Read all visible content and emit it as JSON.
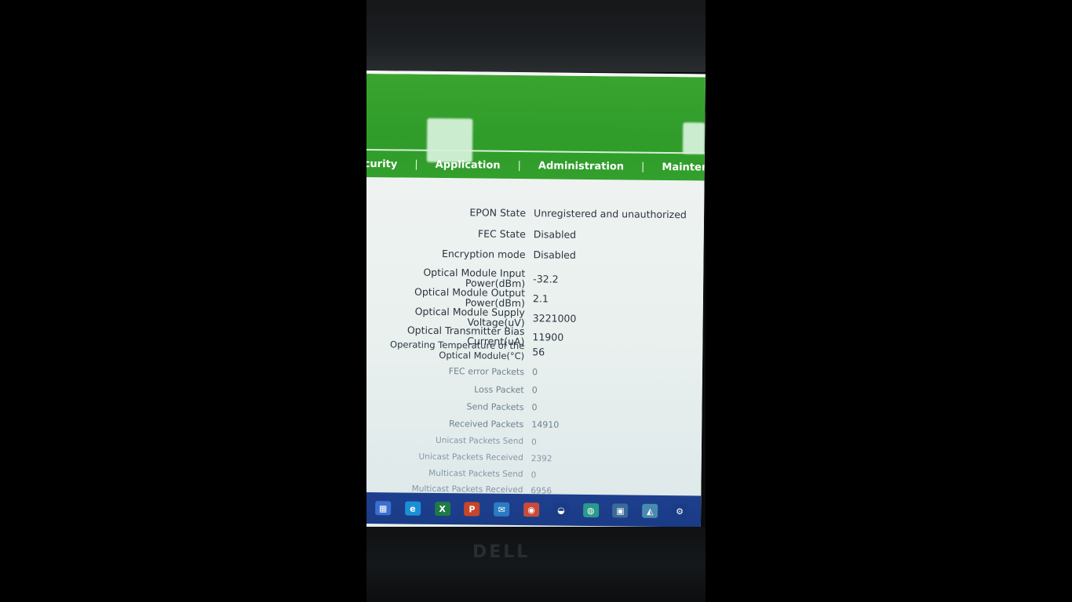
{
  "nav": {
    "items": [
      {
        "id": "security",
        "label": "curity"
      },
      {
        "id": "application",
        "label": "Application"
      },
      {
        "id": "administration",
        "label": "Administration"
      },
      {
        "id": "maintenance",
        "label": "Maintenan"
      }
    ],
    "separator": "|"
  },
  "status": {
    "rows": [
      {
        "label": "EPON State",
        "value": "Unregistered and unauthorized"
      },
      {
        "label": "FEC State",
        "value": "Disabled"
      },
      {
        "label": "Encryption mode",
        "value": "Disabled"
      },
      {
        "label": "Optical Module Input Power(dBm)",
        "value": "-32.2"
      },
      {
        "label": "Optical Module Output Power(dBm)",
        "value": "2.1"
      },
      {
        "label": "Optical Module Supply Voltage(uV)",
        "value": "3221000"
      },
      {
        "label": "Optical Transmitter Bias Current(uA)",
        "value": "11900"
      },
      {
        "label": "Operating Temperature of the Optical Module(°C)",
        "value": "56"
      },
      {
        "label": "FEC error Packets",
        "value": "0"
      },
      {
        "label": "Loss Packet",
        "value": "0"
      },
      {
        "label": "Send Packets",
        "value": "0"
      },
      {
        "label": "Received Packets",
        "value": "14910"
      },
      {
        "label": "Unicast Packets Send",
        "value": "0"
      },
      {
        "label": "Unicast Packets Received",
        "value": "2392"
      },
      {
        "label": "Multicast Packets Send",
        "value": "0"
      },
      {
        "label": "Multicast Packets Received",
        "value": "6956"
      }
    ]
  },
  "taskbar": {
    "icons": [
      {
        "name": "windows-start-icon",
        "glyph": "▦",
        "color": "#3b6fd0"
      },
      {
        "name": "edge-browser-icon",
        "glyph": "e",
        "color": "#1b8fd6"
      },
      {
        "name": "excel-icon",
        "glyph": "X",
        "color": "#1f7a45"
      },
      {
        "name": "powerpoint-icon",
        "glyph": "P",
        "color": "#c8452a"
      },
      {
        "name": "mail-icon",
        "glyph": "✉",
        "color": "#2a7bc4"
      },
      {
        "name": "chrome-icon",
        "glyph": "◉",
        "color": "#c94a3a"
      },
      {
        "name": "app-icon",
        "glyph": "◒",
        "color": "#1a3b86"
      },
      {
        "name": "globe-icon",
        "glyph": "◍",
        "color": "#2a9a8a"
      },
      {
        "name": "store-icon",
        "glyph": "▣",
        "color": "#3a6a9a"
      },
      {
        "name": "photos-icon",
        "glyph": "◭",
        "color": "#4a8ab0"
      },
      {
        "name": "settings-gear-icon",
        "glyph": "⚙",
        "color": "#1a3b86"
      }
    ]
  },
  "colors": {
    "header_green": "#33a02c",
    "taskbar_blue": "#1a3b86",
    "text": "#2c3440"
  }
}
